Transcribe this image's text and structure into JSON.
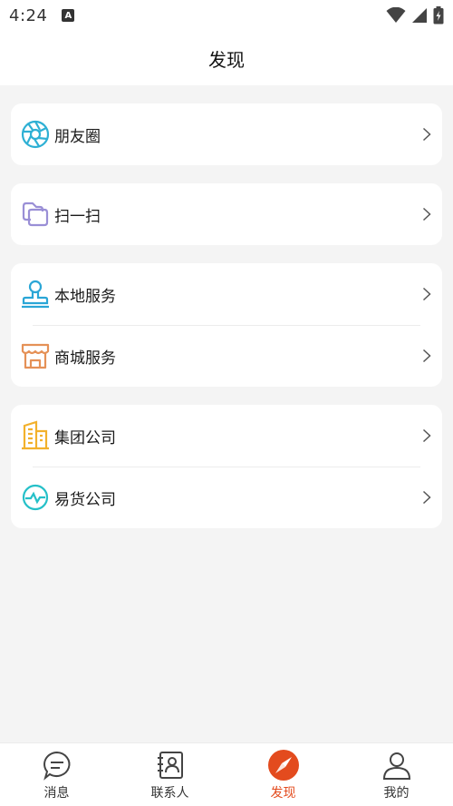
{
  "status_bar": {
    "time": "4:24",
    "notification_icon": "android-a-icon",
    "icons": [
      "wifi-icon",
      "signal-icon",
      "battery-icon"
    ]
  },
  "header": {
    "title": "发现"
  },
  "sections": [
    {
      "items": [
        {
          "label": "朋友圈",
          "icon": "camera-aperture-icon",
          "color": "#2eb0d4"
        }
      ]
    },
    {
      "items": [
        {
          "label": "扫一扫",
          "icon": "scan-icon",
          "color": "#9a8fd6"
        }
      ]
    },
    {
      "items": [
        {
          "label": "本地服务",
          "icon": "stamp-icon",
          "color": "#2aa6d6"
        },
        {
          "label": "商城服务",
          "icon": "store-icon",
          "color": "#e59157"
        }
      ]
    },
    {
      "items": [
        {
          "label": "集团公司",
          "icon": "building-icon",
          "color": "#f2b12c"
        },
        {
          "label": "易货公司",
          "icon": "pulse-icon",
          "color": "#25c0c8"
        }
      ]
    }
  ],
  "tabbar": {
    "active_color": "#e34b1e",
    "tabs": [
      {
        "label": "消息",
        "icon": "chat-bubble-icon",
        "active": false
      },
      {
        "label": "联系人",
        "icon": "contacts-book-icon",
        "active": false
      },
      {
        "label": "发现",
        "icon": "compass-icon",
        "active": true
      },
      {
        "label": "我的",
        "icon": "person-icon",
        "active": false
      }
    ]
  }
}
